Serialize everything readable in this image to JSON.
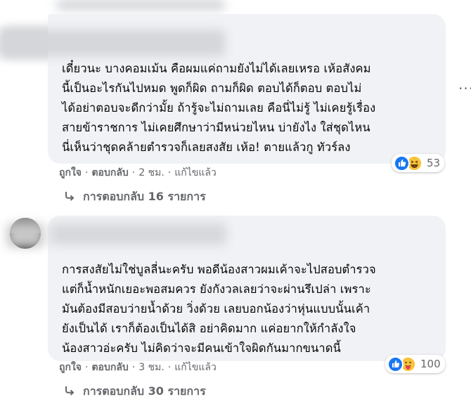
{
  "comment1": {
    "text": "เดี๋ยวนะ บางคอมเม้น คือผมแค่ถามยังไม่ได้เลยเหรอ เห้อสังคม\nนี้เป็นอะไรกันไปหมด พูดก็ผิด ถามก็ผิด ตอบได้ก็ตอบ ตอบไม่\nได้อย่าตอบจะดีกว่ามั้ย ถ้ารู้จะไม่ถามเลย คือนี่ไม่รู้ ไม่เคยรู้เรื่อง\nสายข้าราชการ ไม่เคยศึกษาว่ามีหน่วยไหน บ่ายังไง ใส่ชุดไหน\nนี่เห็นว่าชุดคล้ายตำรวจก็เลยสงสัย เห้อ! ตายแล้วกู ทัวร์ลง",
    "reaction_count": "53",
    "like_label": "ถูกใจ",
    "reply_label": "ตอบกลับ",
    "time": "2 ชม.",
    "edited": "แก้ไขแล้ว",
    "replies": "การตอบกลับ 16 รายการ"
  },
  "comment2": {
    "text": "การสงสัยไม่ใช่บูลลี่นะครับ พอดีน้องสาวผมเค้าจะไปสอบตำรวจ\nแต่ก็น้ำหนักเยอะพอสมควร ยังกังวลเลยว่าจะผ่านรึเปล่า เพราะ\nมันต้องมีสอบว่ายน้ำด้วย วิ่งด้วย เลยบอกน้องว่าหุ่นแบบนั้นเค้า\nยังเป็นได้ เราก็ต้องเป็นได้สิ อย่าคิดมาก แค่อยากให้กำลังใจ\nน้องสาวอ่ะครับ ไม่คิดว่าจะมีคนเข้าใจผิดกันมากขนาดนี้",
    "reaction_count": "100",
    "like_label": "ถูกใจ",
    "reply_label": "ตอบกลับ",
    "time": "3 ชม.",
    "edited": "แก้ไขแล้ว",
    "replies": "การตอบกลับ 30 รายการ"
  },
  "icons": {
    "like": "like-icon",
    "haha": "haha-icon",
    "care": "care-icon",
    "reply_arrow": "reply-arrow-icon",
    "more": "more-options-icon"
  },
  "colors": {
    "bubble": "#f0f2f5",
    "text": "#050505",
    "meta": "#65676b",
    "like_blue": "#1877f2",
    "haha_yellow": "#f7c33b"
  }
}
